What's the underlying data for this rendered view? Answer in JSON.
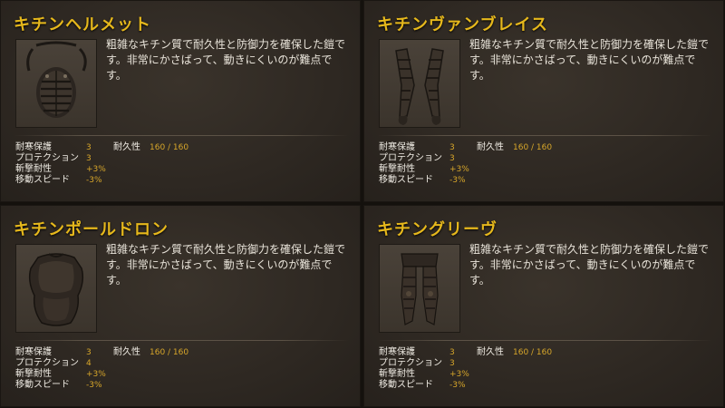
{
  "cards": [
    {
      "title": "キチンヘルメット",
      "icon": "helmet-icon",
      "description": "粗雑なキチン質で耐久性と防御力を確保した鎧です。非常にかさばって、動きにくいのが難点です。",
      "stats": [
        {
          "name": "耐寒保護",
          "value": "3"
        },
        {
          "name": "プロテクション",
          "value": "3"
        },
        {
          "name": "斬撃耐性",
          "value": "+3%"
        },
        {
          "name": "移動スピード",
          "value": "-3%"
        }
      ],
      "durability_label": "耐久性",
      "durability_value": "160 / 160"
    },
    {
      "title": "キチンヴァンブレイス",
      "icon": "vambrace-icon",
      "description": "粗雑なキチン質で耐久性と防御力を確保した鎧です。非常にかさばって、動きにくいのが難点です。",
      "stats": [
        {
          "name": "耐寒保護",
          "value": "3"
        },
        {
          "name": "プロテクション",
          "value": "3"
        },
        {
          "name": "斬撃耐性",
          "value": "+3%"
        },
        {
          "name": "移動スピード",
          "value": "-3%"
        }
      ],
      "durability_label": "耐久性",
      "durability_value": "160 / 160"
    },
    {
      "title": "キチンポールドロン",
      "icon": "pauldron-icon",
      "description": "粗雑なキチン質で耐久性と防御力を確保した鎧です。非常にかさばって、動きにくいのが難点です。",
      "stats": [
        {
          "name": "耐寒保護",
          "value": "3"
        },
        {
          "name": "プロテクション",
          "value": "4"
        },
        {
          "name": "斬撃耐性",
          "value": "+3%"
        },
        {
          "name": "移動スピード",
          "value": "-3%"
        }
      ],
      "durability_label": "耐久性",
      "durability_value": "160 / 160"
    },
    {
      "title": "キチングリーヴ",
      "icon": "greaves-icon",
      "description": "粗雑なキチン質で耐久性と防御力を確保した鎧です。非常にかさばって、動きにくいのが難点です。",
      "stats": [
        {
          "name": "耐寒保護",
          "value": "3"
        },
        {
          "name": "プロテクション",
          "value": "3"
        },
        {
          "name": "斬撃耐性",
          "value": "+3%"
        },
        {
          "name": "移動スピード",
          "value": "-3%"
        }
      ],
      "durability_label": "耐久性",
      "durability_value": "160 / 160"
    }
  ],
  "colors": {
    "title": "#e6b81c",
    "value": "#d7a62a",
    "text": "#e9e4da",
    "panel": "#2e2822"
  }
}
